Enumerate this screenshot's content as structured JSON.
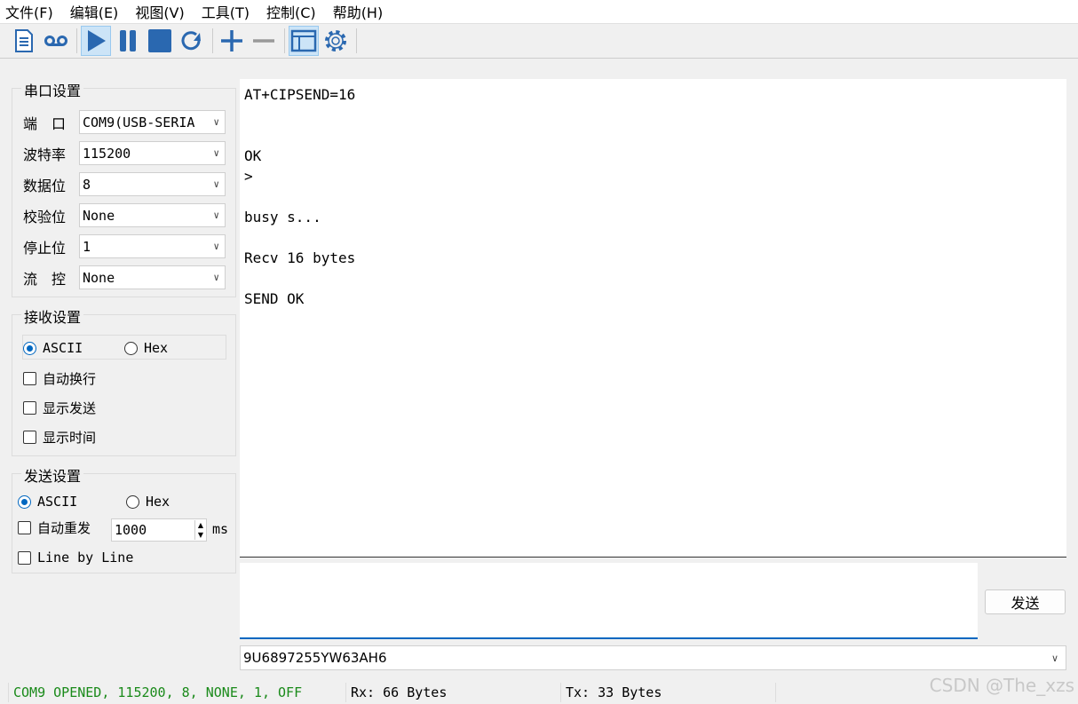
{
  "menu": [
    "文件(F)",
    "编辑(E)",
    "视图(V)",
    "工具(T)",
    "控制(C)",
    "帮助(H)"
  ],
  "serial": {
    "title": "串口设置",
    "rows": [
      {
        "label": "端　口",
        "value": "COM9(USB-SERIA"
      },
      {
        "label": "波特率",
        "value": "115200"
      },
      {
        "label": "数据位",
        "value": "8"
      },
      {
        "label": "校验位",
        "value": "None"
      },
      {
        "label": "停止位",
        "value": "1"
      },
      {
        "label": "流　控",
        "value": "None"
      }
    ]
  },
  "receive": {
    "title": "接收设置",
    "ascii": "ASCII",
    "hex": "Hex",
    "auto_wrap": "自动换行",
    "show_send": "显示发送",
    "show_time": "显示时间"
  },
  "sendset": {
    "title": "发送设置",
    "ascii": "ASCII",
    "hex": "Hex",
    "auto_resend": "自动重发",
    "interval": "1000",
    "unit": "ms",
    "line_by_line": "Line by Line"
  },
  "recv_text": "AT+CIPSEND=16\n\n\nOK\n>\n\nbusy s...\n\nRecv 16 bytes\n\nSEND OK",
  "send_button": "发送",
  "history_value": "9U6897255YW63AH6",
  "status": {
    "port": "COM9 OPENED, 115200, 8, NONE, 1, OFF",
    "rx": "Rx: 66 Bytes",
    "tx": "Tx: 33 Bytes"
  },
  "watermark": "CSDN @The_xzs",
  "colors": {
    "accent": "#2a68b0",
    "status_green": "#1a8a1a"
  }
}
